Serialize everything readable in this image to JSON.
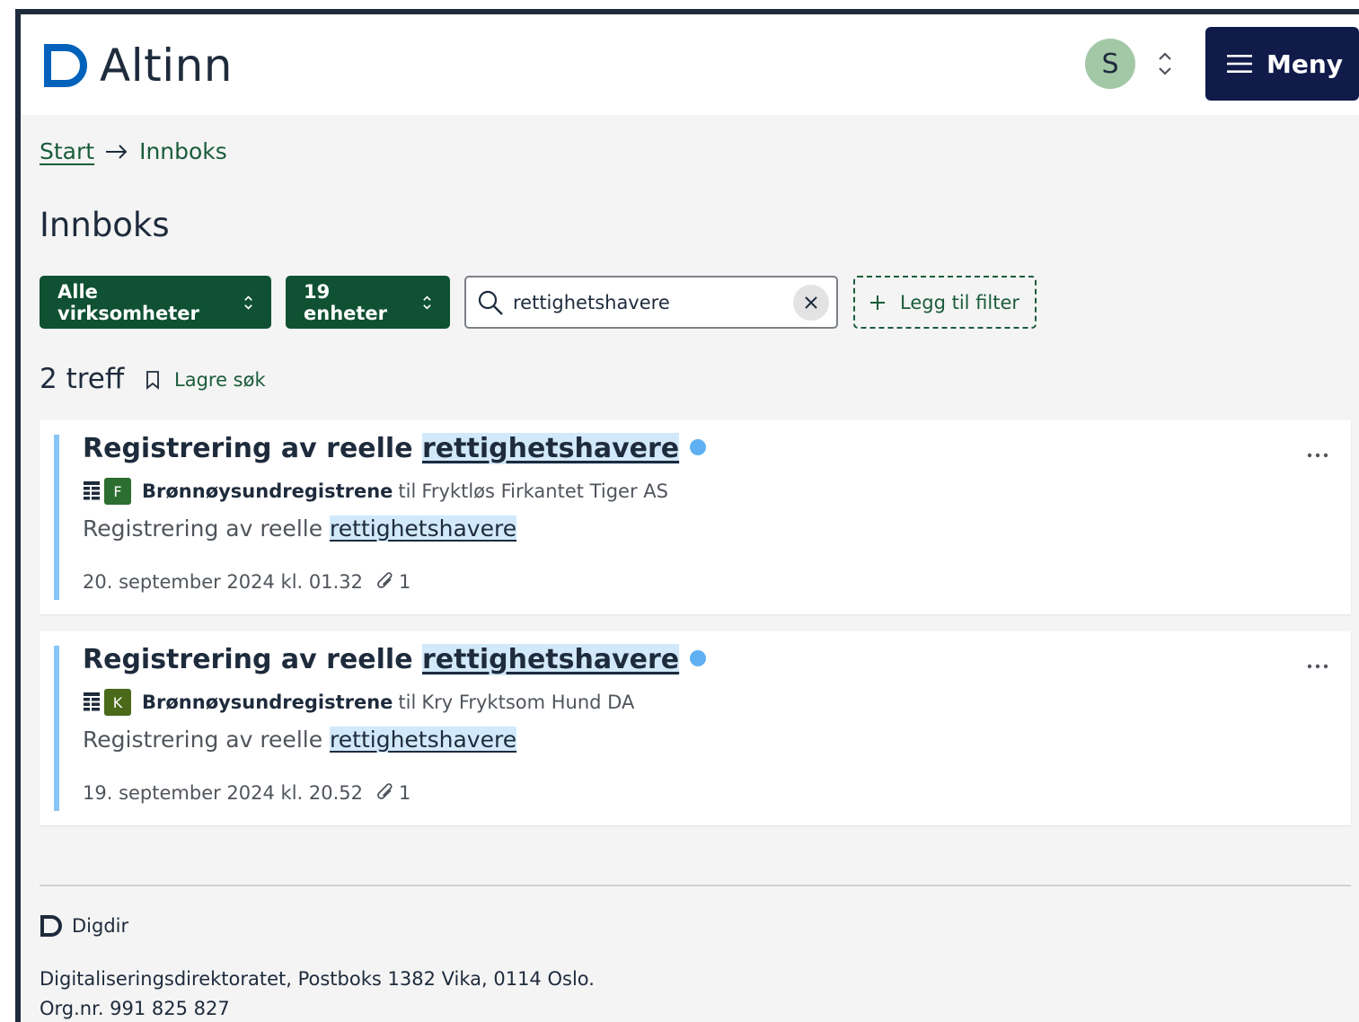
{
  "header": {
    "logo_text": "Altinn",
    "avatar_initial": "S",
    "menu_label": "Meny",
    "colors": {
      "menu_bg": "#101b4a",
      "logo_blue": "#0062ba",
      "avatar_bg": "#a3c8a6"
    }
  },
  "breadcrumb": {
    "start": "Start",
    "current": "Innboks"
  },
  "page_title": "Innboks",
  "filters": {
    "organizations_label": "Alle virksomheter",
    "units_label": "19 enheter",
    "search_value": "rettighetshavere",
    "add_filter_label": "Legg til filter",
    "colors": {
      "primary_green": "#0f5132"
    }
  },
  "results": {
    "count_label": "2 treff",
    "save_search_label": "Lagre søk"
  },
  "messages": [
    {
      "title_prefix": "Registrering av reelle ",
      "title_highlight": "rettighetshavere",
      "org_badge": "F",
      "org_badge_color": "#2c6e2f",
      "sender": "Brønnøysundregistrene",
      "to_label": "til",
      "recipient": "Fryktløs Firkantet Tiger AS",
      "summary_prefix": "Registrering av reelle ",
      "summary_highlight": "rettighetshavere",
      "date": "20. september 2024 kl. 01.32",
      "attachments": "1"
    },
    {
      "title_prefix": "Registrering av reelle ",
      "title_highlight": "rettighetshavere",
      "org_badge": "K",
      "org_badge_color": "#4a6a1a",
      "sender": "Brønnøysundregistrene",
      "to_label": "til",
      "recipient": "Kry Fryktsom Hund DA",
      "summary_prefix": "Registrering av reelle ",
      "summary_highlight": "rettighetshavere",
      "date": "19. september 2024 kl. 20.52",
      "attachments": "1"
    }
  ],
  "footer": {
    "brand": "Digdir",
    "address_line1": "Digitaliseringsdirektoratet, Postboks 1382 Vika, 0114 Oslo.",
    "address_line2": "Org.nr. 991 825 827"
  }
}
